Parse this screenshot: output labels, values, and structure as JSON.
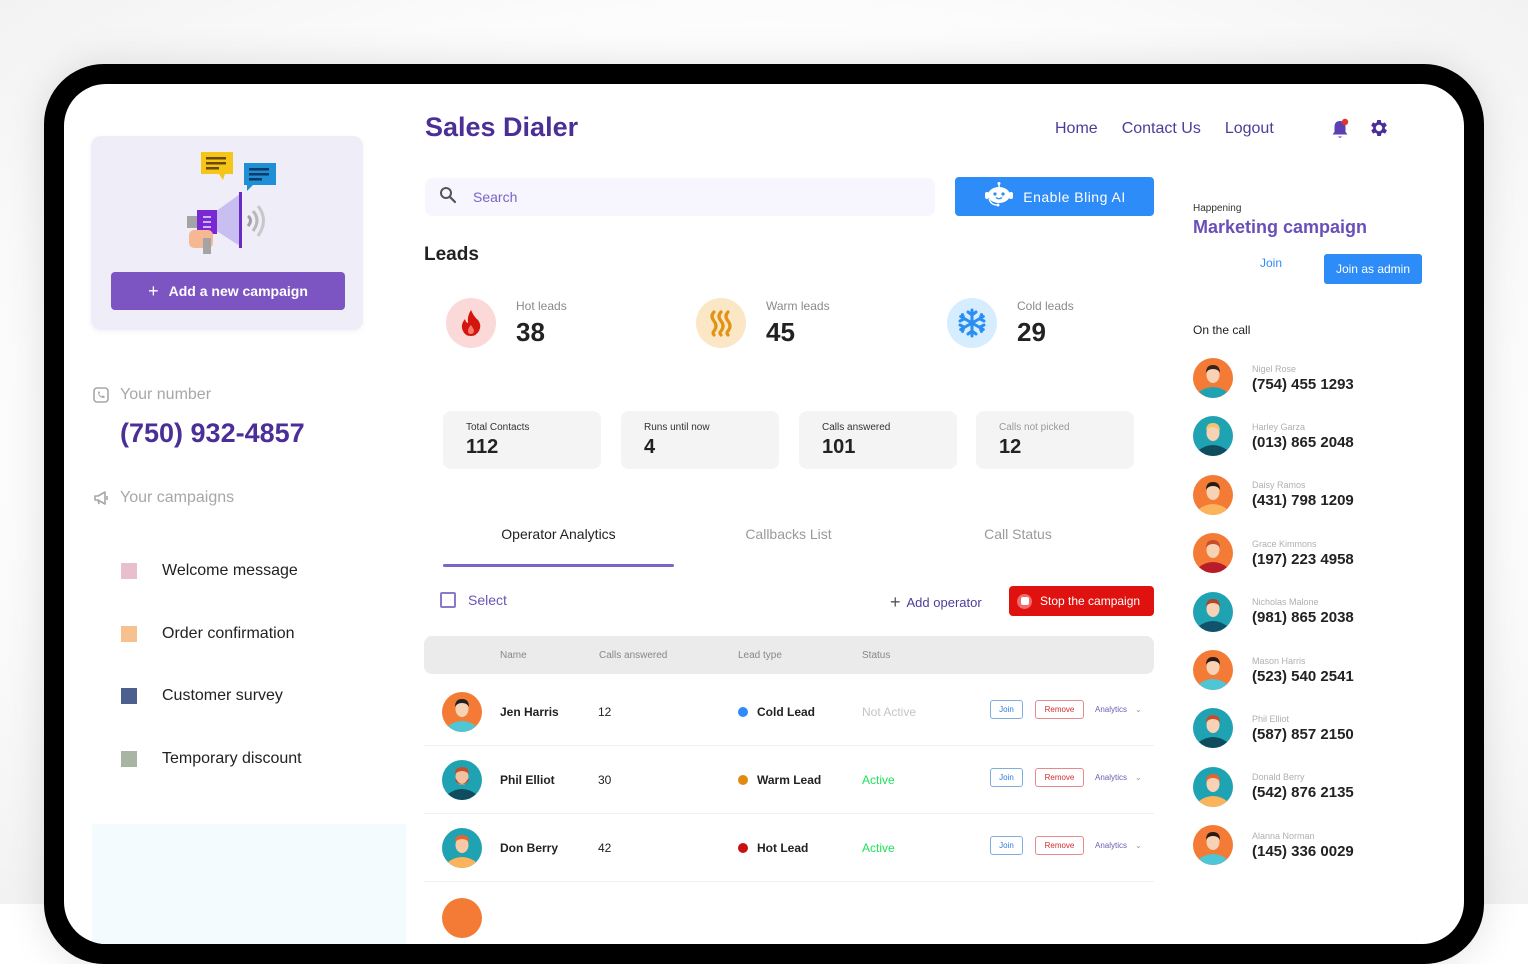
{
  "app": {
    "title": "Sales Dialer"
  },
  "nav": {
    "items": [
      "Home",
      "Contact Us",
      "Logout"
    ]
  },
  "icons": {
    "notifications": "bell-icon",
    "settings": "gear-icon",
    "search": "search-icon",
    "bot": "robot-icon"
  },
  "sidebar": {
    "add_campaign_label": "Add a new campaign",
    "your_number_label": "Your number",
    "your_number": "(750) 932-4857",
    "your_campaigns_label": "Your campaigns",
    "campaigns": [
      {
        "name": "Welcome message",
        "color": "#e8bfcc"
      },
      {
        "name": "Order confirmation",
        "color": "#f7c08f"
      },
      {
        "name": "Customer survey",
        "color": "#4d5f8f"
      },
      {
        "name": "Temporary discount",
        "color": "#a9b5a3"
      }
    ]
  },
  "search": {
    "placeholder": "Search"
  },
  "bling": {
    "label": "Enable Bling AI"
  },
  "leads": {
    "title": "Leads",
    "hot": {
      "label": "Hot leads",
      "value": "38"
    },
    "warm": {
      "label": "Warm leads",
      "value": "45"
    },
    "cold": {
      "label": "Cold leads",
      "value": "29"
    }
  },
  "kpis": [
    {
      "label": "Total Contacts",
      "value": "112"
    },
    {
      "label": "Runs until now",
      "value": "4"
    },
    {
      "label": "Calls answered",
      "value": "101"
    },
    {
      "label": "Calls not picked",
      "value": "12"
    }
  ],
  "tabs": [
    {
      "label": "Operator Analytics",
      "active": true
    },
    {
      "label": "Callbacks List",
      "active": false
    },
    {
      "label": "Call Status",
      "active": false
    }
  ],
  "toolbar": {
    "select_label": "Select",
    "add_operator_label": "Add operator",
    "stop_label": "Stop the campaign"
  },
  "table": {
    "headers": [
      "Name",
      "Calls answered",
      "Lead type",
      "Status"
    ],
    "row_actions": {
      "join": "Join",
      "remove": "Remove",
      "analytics": "Analytics"
    },
    "rows": [
      {
        "name": "Jen Harris",
        "calls": "12",
        "lead_type": "Cold Lead",
        "lead_color": "#2d8cf7",
        "status": "Not Active",
        "status_color": "#c4c4c4"
      },
      {
        "name": "Phil Elliot",
        "calls": "30",
        "lead_type": "Warm Lead",
        "lead_color": "#e08a10",
        "status": "Active",
        "status_color": "#21e05a"
      },
      {
        "name": "Don Berry",
        "calls": "42",
        "lead_type": "Hot Lead",
        "lead_color": "#c8120f",
        "status": "Active",
        "status_color": "#21e05a"
      }
    ]
  },
  "happening": {
    "label": "Happening",
    "campaign": "Marketing campaign",
    "join_label": "Join",
    "join_admin_label": "Join as admin"
  },
  "on_call": {
    "label": "On the call",
    "callers": [
      {
        "name": "Nigel Rose",
        "phone": "(754) 455 1293"
      },
      {
        "name": "Harley Garza",
        "phone": "(013) 865 2048"
      },
      {
        "name": "Daisy Ramos",
        "phone": "(431) 798 1209"
      },
      {
        "name": "Grace Kimmons",
        "phone": "(197) 223 4958"
      },
      {
        "name": "Nicholas Malone",
        "phone": "(981) 865 2038"
      },
      {
        "name": "Mason Harris",
        "phone": "(523) 540 2541"
      },
      {
        "name": "Phil Elliot",
        "phone": "(587) 857 2150"
      },
      {
        "name": "Donald Berry",
        "phone": "(542) 876 2135"
      },
      {
        "name": "Alanna Norman",
        "phone": "(145) 336 0029"
      }
    ]
  },
  "colors": {
    "brand": "#4b2f97",
    "accent_purple": "#7c55c3",
    "accent_blue": "#2d8cf7",
    "danger": "#e0120f"
  }
}
